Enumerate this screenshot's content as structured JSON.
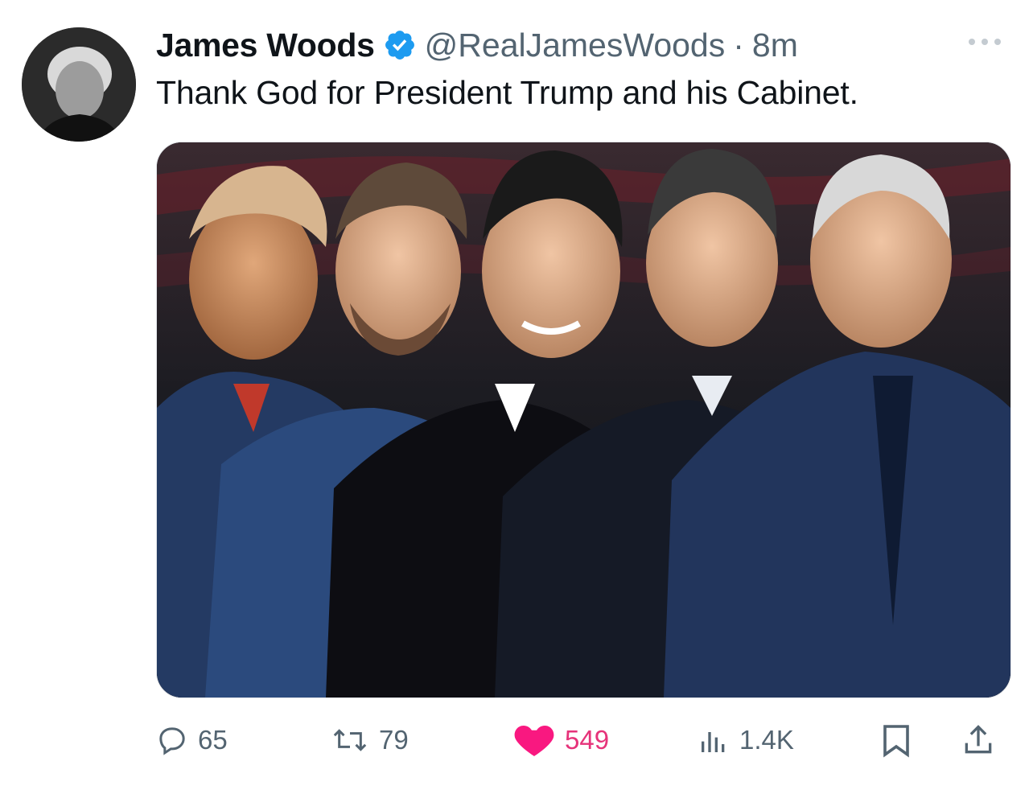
{
  "tweet": {
    "author_name": "James Woods",
    "handle": "@RealJamesWoods",
    "separator": "·",
    "time": "8m",
    "text": "Thank God for President Trump and his Cabinet.",
    "verified": true,
    "avatar_icon": "profile-photo"
  },
  "media": {
    "kind": "photo",
    "description_icon": "five-men-in-suits-photo"
  },
  "actions": {
    "replies": "65",
    "retweets": "79",
    "likes": "549",
    "views": "1.4K",
    "liked": true,
    "like_color": "#f91880"
  },
  "colors": {
    "verified": "#1d9bf0",
    "secondary_text": "#536471",
    "like": "#f91880"
  }
}
